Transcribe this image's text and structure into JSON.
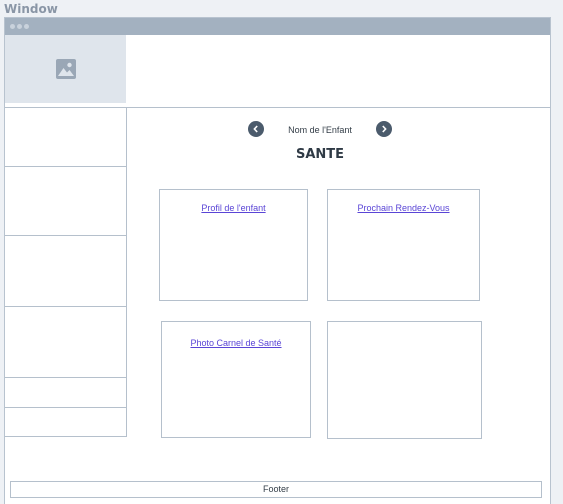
{
  "window": {
    "label": "Window"
  },
  "header": {
    "logo_icon": "image-placeholder-icon"
  },
  "nav": {
    "child_name": "Nom de l'Enfant",
    "prev_icon": "chevron-left-icon",
    "next_icon": "chevron-right-icon"
  },
  "page": {
    "title": "SANTE"
  },
  "cards": [
    {
      "label": "Profil de l'enfant"
    },
    {
      "label": "Prochain Rendez-Vous"
    },
    {
      "label": "Photo Carnel de Santé"
    },
    {
      "label": ""
    }
  ],
  "footer": {
    "label": "Footer"
  },
  "colors": {
    "accent_link": "#5a45d6",
    "titlebar": "#a3b1c0",
    "nav_button": "#4b5b6c"
  }
}
